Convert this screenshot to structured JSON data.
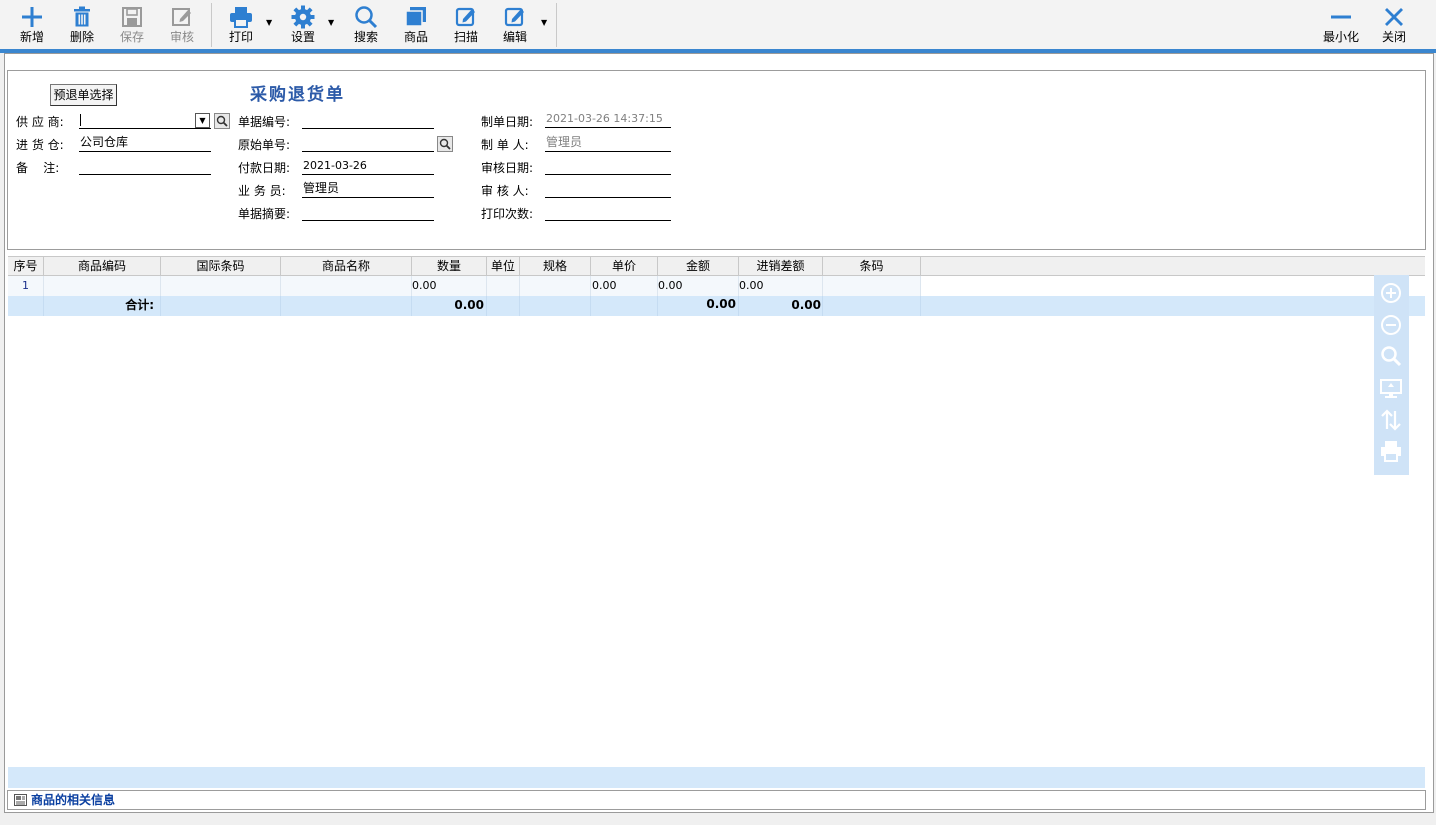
{
  "toolbar": {
    "add": "新增",
    "delete": "删除",
    "save": "保存",
    "audit": "审核",
    "print": "打印",
    "settings": "设置",
    "search": "搜索",
    "product": "商品",
    "scan": "扫描",
    "edit": "编辑",
    "minimize": "最小化",
    "close": "关闭"
  },
  "colors": {
    "accent": "#3a86cf",
    "icon_blue": "#2e7fd1",
    "title_blue": "#2c5aa8",
    "row_highlight": "#d4e8fa"
  },
  "form": {
    "pre_return_select": "预退单选择",
    "title": "采购退货单",
    "supplier_label": "供 应 商:",
    "supplier_value": "",
    "warehouse_label": "进 货 仓:",
    "warehouse_value": "公司仓库",
    "remark_label": "备    注:",
    "remark_value": "",
    "doc_no_label": "单据编号:",
    "doc_no_value": "",
    "orig_no_label": "原始单号:",
    "orig_no_value": "",
    "pay_date_label": "付款日期:",
    "pay_date_value": "2021-03-26",
    "salesman_label": "业 务 员:",
    "salesman_value": "管理员",
    "summary_label": "单据摘要:",
    "summary_value": "",
    "create_date_label": "制单日期:",
    "create_date_value": "2021-03-26 14:37:15",
    "creator_label": "制 单 人:",
    "creator_value": "管理员",
    "audit_date_label": "审核日期:",
    "audit_date_value": "",
    "auditor_label": "审 核 人:",
    "auditor_value": "",
    "print_count_label": "打印次数:",
    "print_count_value": ""
  },
  "grid": {
    "columns": [
      "序号",
      "商品编码",
      "国际条码",
      "商品名称",
      "数量",
      "单位",
      "规格",
      "单价",
      "金额",
      "进销差额",
      "条码"
    ],
    "row1": {
      "seq": "1",
      "qty": "0.00",
      "unit_price": "0.00",
      "amount": "0.00",
      "diff": "0.00"
    },
    "total": {
      "label": "合计:",
      "qty": "0.00",
      "amount": "0.00",
      "diff": "0.00"
    }
  },
  "side_tools": [
    "zoom-in-icon",
    "zoom-out-icon",
    "search-icon",
    "monitor-icon",
    "sort-icon",
    "printer-icon"
  ],
  "info_bar": {
    "text": "商品的相关信息"
  }
}
